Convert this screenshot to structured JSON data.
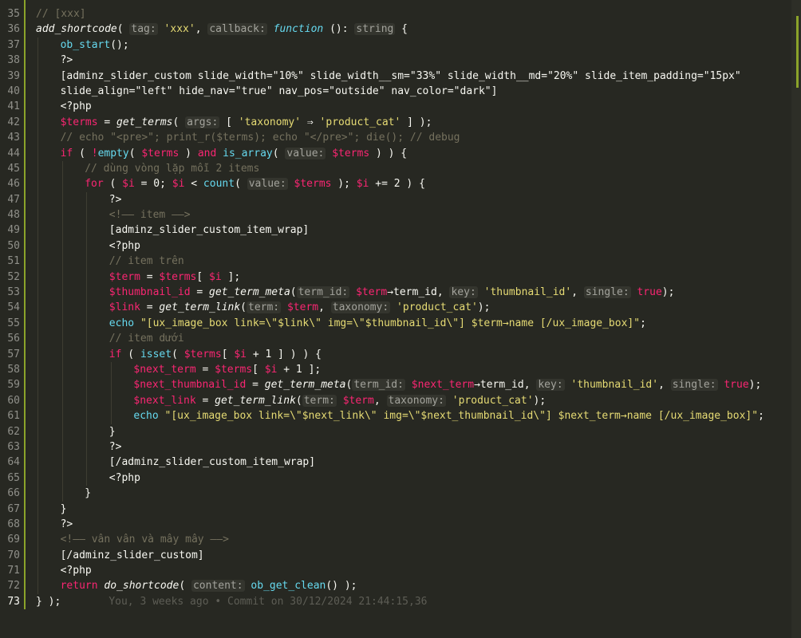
{
  "lines": [
    {
      "n": "35",
      "indent": 0,
      "segs": [
        {
          "c": "c",
          "t": "// [xxx]"
        }
      ]
    },
    {
      "n": "36",
      "indent": 0,
      "segs": [
        {
          "c": "fn",
          "t": "add_shortcode"
        },
        {
          "c": "",
          "t": "( "
        },
        {
          "c": "h",
          "t": "tag:"
        },
        {
          "c": "",
          "t": " "
        },
        {
          "c": "s",
          "t": "'xxx'"
        },
        {
          "c": "",
          "t": ", "
        },
        {
          "c": "h",
          "t": "callback:"
        },
        {
          "c": "",
          "t": " "
        },
        {
          "c": "i",
          "t": "function"
        },
        {
          "c": "",
          "t": " (): "
        },
        {
          "c": "h",
          "t": "string"
        },
        {
          "c": "",
          "t": " {"
        }
      ]
    },
    {
      "n": "37",
      "indent": 1,
      "segs": [
        {
          "c": "fc",
          "t": "ob_start"
        },
        {
          "c": "",
          "t": "();"
        }
      ]
    },
    {
      "n": "38",
      "indent": 1,
      "segs": [
        {
          "c": "",
          "t": "?>"
        }
      ]
    },
    {
      "n": "39",
      "indent": 1,
      "segs": [
        {
          "c": "",
          "t": "[adminz_slider_custom slide_width=\"10%\" slide_width__sm=\"33%\" slide_width__md=\"20%\" slide_item_padding=\"15px\""
        }
      ]
    },
    {
      "n": "40",
      "indent": 1,
      "segs": [
        {
          "c": "",
          "t": "slide_align=\"left\" hide_nav=\"true\" nav_pos=\"outside\" nav_color=\"dark\"]"
        }
      ]
    },
    {
      "n": "41",
      "indent": 1,
      "segs": [
        {
          "c": "",
          "t": "<?php"
        }
      ]
    },
    {
      "n": "42",
      "indent": 1,
      "segs": [
        {
          "c": "v",
          "t": "$terms"
        },
        {
          "c": "",
          "t": " = "
        },
        {
          "c": "fn",
          "t": "get_terms"
        },
        {
          "c": "",
          "t": "( "
        },
        {
          "c": "h",
          "t": "args:"
        },
        {
          "c": "",
          "t": " [ "
        },
        {
          "c": "s",
          "t": "'taxonomy'"
        },
        {
          "c": "",
          "t": " ⇒ "
        },
        {
          "c": "s",
          "t": "'product_cat'"
        },
        {
          "c": "",
          "t": " ] );"
        }
      ]
    },
    {
      "n": "43",
      "indent": 1,
      "segs": [
        {
          "c": "c",
          "t": "// echo \"<pre>\"; print_r($terms); echo \"</pre>\"; die(); // debug"
        }
      ]
    },
    {
      "n": "44",
      "indent": 1,
      "segs": [
        {
          "c": "k",
          "t": "if"
        },
        {
          "c": "",
          "t": " ( "
        },
        {
          "c": "k",
          "t": "!"
        },
        {
          "c": "fc",
          "t": "empty"
        },
        {
          "c": "",
          "t": "( "
        },
        {
          "c": "v",
          "t": "$terms"
        },
        {
          "c": "",
          "t": " ) "
        },
        {
          "c": "k",
          "t": "and"
        },
        {
          "c": "",
          "t": " "
        },
        {
          "c": "fc",
          "t": "is_array"
        },
        {
          "c": "",
          "t": "( "
        },
        {
          "c": "h",
          "t": "value:"
        },
        {
          "c": "",
          "t": " "
        },
        {
          "c": "v",
          "t": "$terms"
        },
        {
          "c": "",
          "t": " ) ) {"
        }
      ]
    },
    {
      "n": "45",
      "indent": 2,
      "segs": [
        {
          "c": "c",
          "t": "// dùng vòng lặp mỗi 2 items"
        }
      ]
    },
    {
      "n": "46",
      "indent": 2,
      "segs": [
        {
          "c": "k",
          "t": "for"
        },
        {
          "c": "",
          "t": " ( "
        },
        {
          "c": "v",
          "t": "$i"
        },
        {
          "c": "",
          "t": " = 0; "
        },
        {
          "c": "v",
          "t": "$i"
        },
        {
          "c": "",
          "t": " < "
        },
        {
          "c": "fc",
          "t": "count"
        },
        {
          "c": "",
          "t": "( "
        },
        {
          "c": "h",
          "t": "value:"
        },
        {
          "c": "",
          "t": " "
        },
        {
          "c": "v",
          "t": "$terms"
        },
        {
          "c": "",
          "t": " ); "
        },
        {
          "c": "v",
          "t": "$i"
        },
        {
          "c": "",
          "t": " += 2 ) {"
        }
      ]
    },
    {
      "n": "47",
      "indent": 3,
      "segs": [
        {
          "c": "",
          "t": "?>"
        }
      ]
    },
    {
      "n": "48",
      "indent": 3,
      "segs": [
        {
          "c": "c",
          "t": "<!—— item ——>"
        }
      ]
    },
    {
      "n": "49",
      "indent": 3,
      "segs": [
        {
          "c": "",
          "t": "[adminz_slider_custom_item_wrap]"
        }
      ]
    },
    {
      "n": "50",
      "indent": 3,
      "segs": [
        {
          "c": "",
          "t": "<?php"
        }
      ]
    },
    {
      "n": "51",
      "indent": 3,
      "segs": [
        {
          "c": "c",
          "t": "// item trên"
        }
      ]
    },
    {
      "n": "52",
      "indent": 3,
      "segs": [
        {
          "c": "v",
          "t": "$term"
        },
        {
          "c": "",
          "t": " = "
        },
        {
          "c": "v",
          "t": "$terms"
        },
        {
          "c": "",
          "t": "[ "
        },
        {
          "c": "v",
          "t": "$i"
        },
        {
          "c": "",
          "t": " ];"
        }
      ]
    },
    {
      "n": "53",
      "indent": 3,
      "segs": [
        {
          "c": "v",
          "t": "$thumbnail_id"
        },
        {
          "c": "",
          "t": " = "
        },
        {
          "c": "fn",
          "t": "get_term_meta"
        },
        {
          "c": "",
          "t": "("
        },
        {
          "c": "h",
          "t": "term_id:"
        },
        {
          "c": "",
          "t": " "
        },
        {
          "c": "v",
          "t": "$term"
        },
        {
          "c": "",
          "t": "→term_id, "
        },
        {
          "c": "h",
          "t": "key:"
        },
        {
          "c": "",
          "t": " "
        },
        {
          "c": "s",
          "t": "'thumbnail_id'"
        },
        {
          "c": "",
          "t": ", "
        },
        {
          "c": "h",
          "t": "single:"
        },
        {
          "c": "",
          "t": " "
        },
        {
          "c": "k",
          "t": "true"
        },
        {
          "c": "",
          "t": ");"
        }
      ]
    },
    {
      "n": "54",
      "indent": 3,
      "segs": [
        {
          "c": "v",
          "t": "$link"
        },
        {
          "c": "",
          "t": " = "
        },
        {
          "c": "fn",
          "t": "get_term_link"
        },
        {
          "c": "",
          "t": "("
        },
        {
          "c": "h",
          "t": "term:"
        },
        {
          "c": "",
          "t": " "
        },
        {
          "c": "v",
          "t": "$term"
        },
        {
          "c": "",
          "t": ", "
        },
        {
          "c": "h",
          "t": "taxonomy:"
        },
        {
          "c": "",
          "t": " "
        },
        {
          "c": "s",
          "t": "'product_cat'"
        },
        {
          "c": "",
          "t": ");"
        }
      ]
    },
    {
      "n": "55",
      "indent": 3,
      "segs": [
        {
          "c": "fc",
          "t": "echo"
        },
        {
          "c": "",
          "t": " "
        },
        {
          "c": "s",
          "t": "\"[ux_image_box link=\\\"$link\\\" img=\\\"$thumbnail_id\\\"] $term→name [/ux_image_box]\""
        },
        {
          "c": "",
          "t": ";"
        }
      ]
    },
    {
      "n": "56",
      "indent": 3,
      "segs": [
        {
          "c": "c",
          "t": "// item dưới"
        }
      ]
    },
    {
      "n": "57",
      "indent": 3,
      "segs": [
        {
          "c": "k",
          "t": "if"
        },
        {
          "c": "",
          "t": " ( "
        },
        {
          "c": "fc",
          "t": "isset"
        },
        {
          "c": "",
          "t": "( "
        },
        {
          "c": "v",
          "t": "$terms"
        },
        {
          "c": "",
          "t": "[ "
        },
        {
          "c": "v",
          "t": "$i"
        },
        {
          "c": "",
          "t": " + 1 ] ) ) {"
        }
      ]
    },
    {
      "n": "58",
      "indent": 4,
      "segs": [
        {
          "c": "v",
          "t": "$next_term"
        },
        {
          "c": "",
          "t": " = "
        },
        {
          "c": "v",
          "t": "$terms"
        },
        {
          "c": "",
          "t": "[ "
        },
        {
          "c": "v",
          "t": "$i"
        },
        {
          "c": "",
          "t": " + 1 ];"
        }
      ]
    },
    {
      "n": "59",
      "indent": 4,
      "segs": [
        {
          "c": "v",
          "t": "$next_thumbnail_id"
        },
        {
          "c": "",
          "t": " = "
        },
        {
          "c": "fn",
          "t": "get_term_meta"
        },
        {
          "c": "",
          "t": "("
        },
        {
          "c": "h",
          "t": "term_id:"
        },
        {
          "c": "",
          "t": " "
        },
        {
          "c": "v",
          "t": "$next_term"
        },
        {
          "c": "",
          "t": "→term_id, "
        },
        {
          "c": "h",
          "t": "key:"
        },
        {
          "c": "",
          "t": " "
        },
        {
          "c": "s",
          "t": "'thumbnail_id'"
        },
        {
          "c": "",
          "t": ", "
        },
        {
          "c": "h",
          "t": "single:"
        },
        {
          "c": "",
          "t": " "
        },
        {
          "c": "k",
          "t": "true"
        },
        {
          "c": "",
          "t": ");"
        }
      ]
    },
    {
      "n": "60",
      "indent": 4,
      "segs": [
        {
          "c": "v",
          "t": "$next_link"
        },
        {
          "c": "",
          "t": " = "
        },
        {
          "c": "fn",
          "t": "get_term_link"
        },
        {
          "c": "",
          "t": "("
        },
        {
          "c": "h",
          "t": "term:"
        },
        {
          "c": "",
          "t": " "
        },
        {
          "c": "v",
          "t": "$term"
        },
        {
          "c": "",
          "t": ", "
        },
        {
          "c": "h",
          "t": "taxonomy:"
        },
        {
          "c": "",
          "t": " "
        },
        {
          "c": "s",
          "t": "'product_cat'"
        },
        {
          "c": "",
          "t": ");"
        }
      ]
    },
    {
      "n": "61",
      "indent": 4,
      "segs": [
        {
          "c": "fc",
          "t": "echo"
        },
        {
          "c": "",
          "t": " "
        },
        {
          "c": "s",
          "t": "\"[ux_image_box link=\\\"$next_link\\\" img=\\\"$next_thumbnail_id\\\"] $next_term→name [/ux_image_box]\""
        },
        {
          "c": "",
          "t": ";"
        }
      ]
    },
    {
      "n": "62",
      "indent": 3,
      "segs": [
        {
          "c": "",
          "t": "}"
        }
      ]
    },
    {
      "n": "63",
      "indent": 3,
      "segs": [
        {
          "c": "",
          "t": "?>"
        }
      ]
    },
    {
      "n": "64",
      "indent": 3,
      "segs": [
        {
          "c": "",
          "t": "[/adminz_slider_custom_item_wrap]"
        }
      ]
    },
    {
      "n": "65",
      "indent": 3,
      "segs": [
        {
          "c": "",
          "t": "<?php"
        }
      ]
    },
    {
      "n": "66",
      "indent": 2,
      "segs": [
        {
          "c": "",
          "t": "}"
        }
      ]
    },
    {
      "n": "67",
      "indent": 1,
      "segs": [
        {
          "c": "",
          "t": "}"
        }
      ]
    },
    {
      "n": "68",
      "indent": 1,
      "segs": [
        {
          "c": "",
          "t": "?>"
        }
      ]
    },
    {
      "n": "69",
      "indent": 1,
      "segs": [
        {
          "c": "c",
          "t": "<!—— vân vân và mây mây ——>"
        }
      ]
    },
    {
      "n": "70",
      "indent": 1,
      "segs": [
        {
          "c": "",
          "t": "[/adminz_slider_custom]"
        }
      ]
    },
    {
      "n": "71",
      "indent": 1,
      "segs": [
        {
          "c": "",
          "t": "<?php"
        }
      ]
    },
    {
      "n": "72",
      "indent": 1,
      "segs": [
        {
          "c": "k",
          "t": "return"
        },
        {
          "c": "",
          "t": " "
        },
        {
          "c": "fn",
          "t": "do_shortcode"
        },
        {
          "c": "",
          "t": "( "
        },
        {
          "c": "h",
          "t": "content:"
        },
        {
          "c": "",
          "t": " "
        },
        {
          "c": "fc",
          "t": "ob_get_clean"
        },
        {
          "c": "",
          "t": "() );"
        }
      ]
    },
    {
      "n": "73",
      "indent": 0,
      "active": true,
      "segs": [
        {
          "c": "",
          "t": "} );"
        }
      ],
      "blame": "You, 3 weeks ago • Commit on 30/12/2024 21:44:15,36"
    }
  ],
  "colors": {
    "background": "#272822",
    "keyword": "#f92672",
    "string": "#e6db74",
    "comment": "#75715e",
    "builtin": "#66d9ef",
    "gutter_modified": "#8ba32a"
  }
}
